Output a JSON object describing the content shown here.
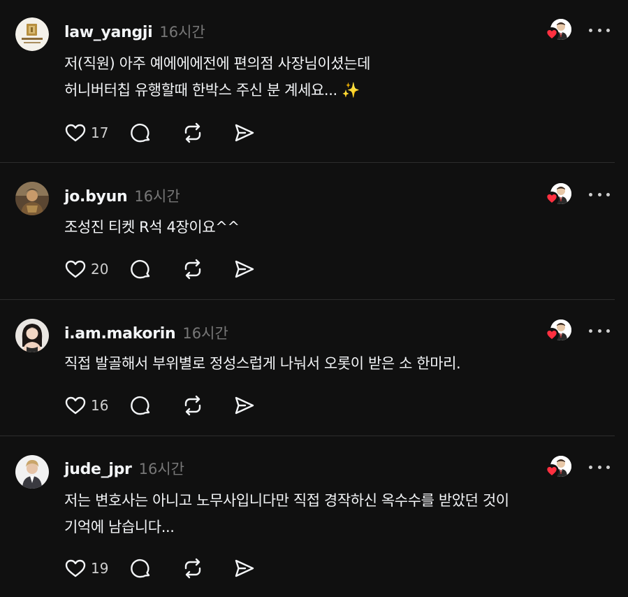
{
  "theme": {
    "background": "#101010",
    "text": "#f3f5f7",
    "muted": "#777777",
    "heart": "#ff3040"
  },
  "posts": [
    {
      "username": "law_yangji",
      "time": "16시간",
      "lines": [
        "저(직원) 아주 예에에에전에 편의점 사장님이셨는데",
        "허니버터칩 유행할때 한박스 주신 분 계세요... ✨"
      ],
      "likes": "17"
    },
    {
      "username": "jo.byun",
      "time": "16시간",
      "lines": [
        "조성진 티켓 R석 4장이요^^"
      ],
      "likes": "20"
    },
    {
      "username": "i.am.makorin",
      "time": "16시간",
      "lines": [
        "직접 발골해서 부위별로 정성스럽게 나눠서 오롯이 받은 소 한마리."
      ],
      "likes": "16"
    },
    {
      "username": "jude_jpr",
      "time": "16시간",
      "lines": [
        "저는 변호사는 아니고 노무사입니다만 직접 경작하신 옥수수를 받았던 것이",
        "기억에 남습니다..."
      ],
      "likes": "19"
    }
  ],
  "icons": {
    "like": "heart-outline-icon",
    "comment": "speech-bubble-icon",
    "repost": "repost-icon",
    "share": "paper-plane-icon",
    "more": "more-horizontal-icon",
    "liked_by": "heart-filled-icon"
  }
}
